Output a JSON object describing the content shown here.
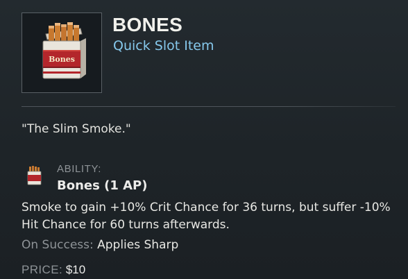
{
  "item": {
    "name": "BONES",
    "type": "Quick Slot Item",
    "icon": "cigarette-pack-icon",
    "pack_brand": "Bones"
  },
  "flavor_text": "\"The Slim Smoke.\"",
  "ability": {
    "header": "ABILITY:",
    "icon": "cigarette-pack-icon",
    "name": "Bones (1 AP)",
    "description": "Smoke to gain +10% Crit Chance for 36 turns, but suffer -10% Hit Chance for 60 turns afterwards.",
    "on_success_label": "On Success:",
    "on_success_value": "Applies Sharp"
  },
  "price": {
    "label": "PRICE:",
    "value": "$10"
  },
  "colors": {
    "background": "#20262b",
    "item_type": "#86c8ec",
    "label_gray": "#8e9397",
    "pack_red": "#b3262b"
  }
}
